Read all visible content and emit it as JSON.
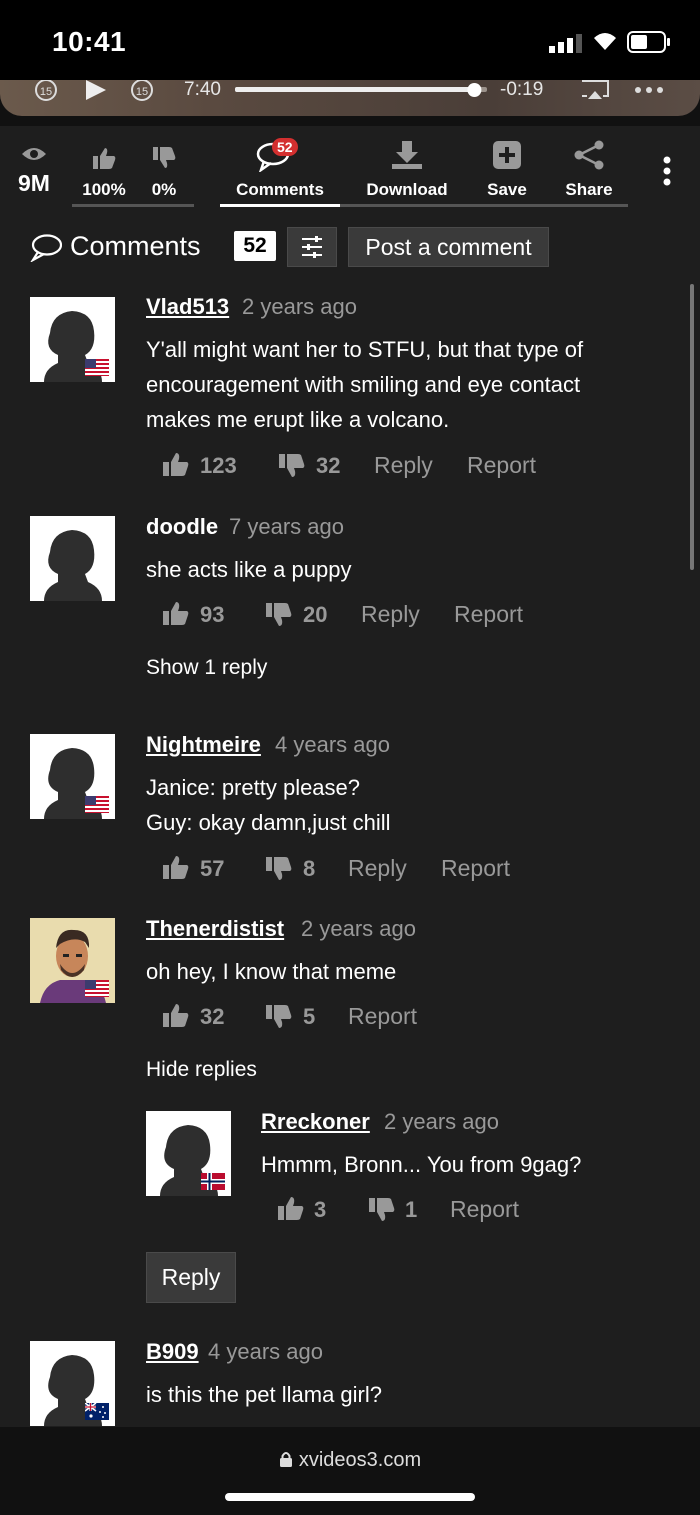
{
  "status_bar": {
    "time": "10:41"
  },
  "player": {
    "current_time": "7:40",
    "remaining_time": "-0:19",
    "skip_back": "15",
    "skip_fwd": "15",
    "progress": 0.95
  },
  "stats": {
    "views": "9M",
    "like_pct": "100%",
    "dislike_pct": "0%"
  },
  "actions": {
    "comments_label": "Comments",
    "comments_count": "52",
    "download_label": "Download",
    "save_label": "Save",
    "share_label": "Share"
  },
  "comments_header": {
    "title": "Comments",
    "count": "52",
    "post_label": "Post a comment"
  },
  "comments": [
    {
      "user": "Vlad513",
      "ago": "2 years ago",
      "lines": [
        "Y'all might want her to STFU, but that type of",
        "encouragement with smiling and eye contact",
        "makes me erupt like a volcano."
      ],
      "likes": "123",
      "dislikes": "32",
      "reply": "Reply",
      "report": "Report",
      "flag": "us"
    },
    {
      "user": "doodle",
      "ago": "7 years ago",
      "lines": [
        "she acts like a puppy"
      ],
      "likes": "93",
      "dislikes": "20",
      "reply": "Reply",
      "report": "Report",
      "show_replies": "Show 1 reply"
    },
    {
      "user": "Nightmeire",
      "ago": "4 years ago",
      "lines": [
        "Janice: pretty please?",
        "Guy: okay damn,just chill"
      ],
      "likes": "57",
      "dislikes": "8",
      "reply": "Reply",
      "report": "Report",
      "flag": "us"
    },
    {
      "user": "Thenerdistist",
      "ago": "2 years ago",
      "lines": [
        "oh hey, I know that meme"
      ],
      "likes": "32",
      "dislikes": "5",
      "report": "Report",
      "hide_replies": "Hide replies",
      "flag": "us"
    },
    {
      "user": "Rreckoner",
      "ago": "2 years ago",
      "lines": [
        "Hmmm, Bronn... You from 9gag?"
      ],
      "likes": "3",
      "dislikes": "1",
      "report": "Report",
      "flag": "no"
    },
    {
      "user": "B909",
      "ago": "4 years ago",
      "lines": [
        "is this the pet llama girl?"
      ],
      "flag": "au"
    }
  ],
  "reply_button": "Reply",
  "browser": {
    "url": "xvideos3.com"
  },
  "colors": {
    "accent_red": "#d32f2f",
    "bg": "#1e1e1e",
    "muted": "#999999"
  }
}
